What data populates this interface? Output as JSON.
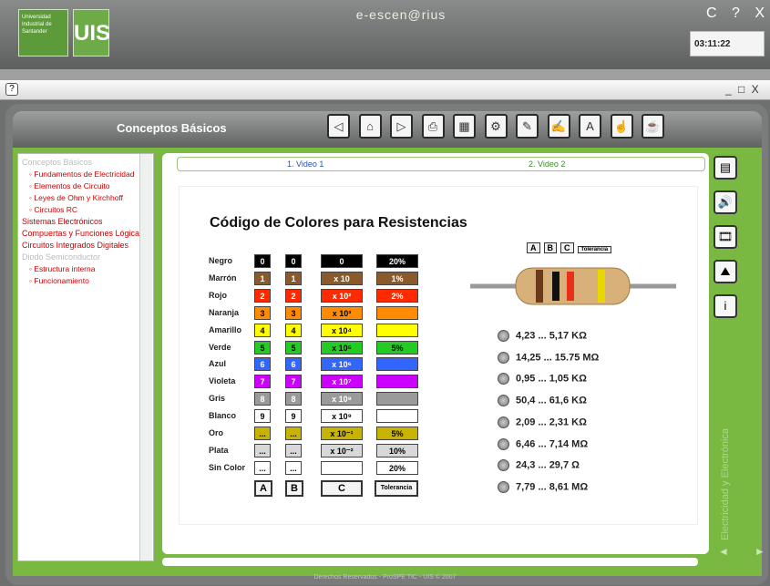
{
  "app": {
    "brand": "e-escen@rius",
    "window_controls": "C ? X",
    "clock": "03:11:22",
    "help": "?",
    "window_buttons": "_ □ X"
  },
  "logo": {
    "university": "Universidad Industrial de Santander",
    "mark": "UIS"
  },
  "header": {
    "title": "Conceptos Básicos",
    "tool_icons": [
      "prev-icon",
      "home-icon",
      "next-icon",
      "print-icon",
      "calculator-icon",
      "network-icon",
      "eraser-icon",
      "pen-icon",
      "font-icon",
      "pointer-icon",
      "cup-icon"
    ],
    "tool_glyphs": [
      "◁",
      "⌂",
      "▷",
      "⎙",
      "▦",
      "⚙",
      "✎",
      "✍",
      "A",
      "☝",
      "☕"
    ]
  },
  "sidebar": {
    "items": [
      {
        "type": "sec grey",
        "label": "Conceptos Básicos"
      },
      {
        "type": "sub",
        "label": "◦ Fundamentos de Electricidad"
      },
      {
        "type": "sub",
        "label": "◦ Elementos de Circuito"
      },
      {
        "type": "sub",
        "label": "◦ Leyes de Ohm y Kirchhoff"
      },
      {
        "type": "sub",
        "label": "◦ Circuitos RC"
      },
      {
        "type": "sec",
        "label": "Sistemas Electrónicos"
      },
      {
        "type": "sec",
        "label": "Compuertas y Funciones Lógicas"
      },
      {
        "type": "sec",
        "label": "Circuitos Integrados Digitales"
      },
      {
        "type": "sec grey",
        "label": "Diodo Semiconductor"
      },
      {
        "type": "sub",
        "label": "◦ Estructura interna"
      },
      {
        "type": "sub",
        "label": "◦ Funcionamiento"
      }
    ]
  },
  "tabs": {
    "video1": "1. Video 1",
    "video2": "2. Video 2"
  },
  "content": {
    "title": "Código de Colores para Resistencias",
    "rows": [
      {
        "label": "Negro",
        "d1": "0",
        "d2": "0",
        "mult": "0",
        "tol": "20%",
        "bg": "#000000",
        "fg": "#ffffff",
        "tolbg": "#000000",
        "tolfg": "#ffffff"
      },
      {
        "label": "Marrón",
        "d1": "1",
        "d2": "1",
        "mult": "x 10",
        "tol": "1%",
        "bg": "#8b5a2b",
        "fg": "#ffffff",
        "tolbg": "#8b5a2b",
        "tolfg": "#ffffff"
      },
      {
        "label": "Rojo",
        "d1": "2",
        "d2": "2",
        "mult": "x 10²",
        "tol": "2%",
        "bg": "#ff2a00",
        "fg": "#ffffff",
        "tolbg": "#ff2a00",
        "tolfg": "#ffffff"
      },
      {
        "label": "Naranja",
        "d1": "3",
        "d2": "3",
        "mult": "x 10³",
        "tol": "",
        "bg": "#ff8c00",
        "fg": "#000000",
        "tolbg": "#ff8c00",
        "tolfg": "#000000"
      },
      {
        "label": "Amarillo",
        "d1": "4",
        "d2": "4",
        "mult": "x 10⁴",
        "tol": "",
        "bg": "#ffff00",
        "fg": "#000000",
        "tolbg": "#ffff00",
        "tolfg": "#000000"
      },
      {
        "label": "Verde",
        "d1": "5",
        "d2": "5",
        "mult": "x 10⁵",
        "tol": "5%",
        "bg": "#22cc22",
        "fg": "#000000",
        "tolbg": "#22cc22",
        "tolfg": "#000000"
      },
      {
        "label": "Azul",
        "d1": "6",
        "d2": "6",
        "mult": "x 10⁶",
        "tol": "",
        "bg": "#3366ff",
        "fg": "#ffffff",
        "tolbg": "#3366ff",
        "tolfg": "#ffffff"
      },
      {
        "label": "Violeta",
        "d1": "7",
        "d2": "7",
        "mult": "x 10⁷",
        "tol": "",
        "bg": "#cc00ff",
        "fg": "#ffffff",
        "tolbg": "#cc00ff",
        "tolfg": "#ffffff"
      },
      {
        "label": "Gris",
        "d1": "8",
        "d2": "8",
        "mult": "x 10⁸",
        "tol": "",
        "bg": "#9a9a9a",
        "fg": "#ffffff",
        "tolbg": "#9a9a9a",
        "tolfg": "#ffffff"
      },
      {
        "label": "Blanco",
        "d1": "9",
        "d2": "9",
        "mult": "x 10⁹",
        "tol": "",
        "bg": "#ffffff",
        "fg": "#000000",
        "tolbg": "#ffffff",
        "tolfg": "#000000"
      },
      {
        "label": "Oro",
        "d1": "...",
        "d2": "...",
        "mult": "x 10⁻¹",
        "tol": "5%",
        "bg": "#c8b400",
        "fg": "#000000",
        "tolbg": "#c8b400",
        "tolfg": "#000000"
      },
      {
        "label": "Plata",
        "d1": "...",
        "d2": "...",
        "mult": "x 10⁻²",
        "tol": "10%",
        "bg": "#d8d8d8",
        "fg": "#000000",
        "tolbg": "#d8d8d8",
        "tolfg": "#000000"
      },
      {
        "label": "Sin Color",
        "d1": "...",
        "d2": "...",
        "mult": "",
        "tol": "20%",
        "bg": "#ffffff",
        "fg": "#000000",
        "tolbg": "#ffffff",
        "tolfg": "#000000"
      }
    ],
    "buttons": {
      "a": "A",
      "b": "B",
      "c": "C",
      "tol": "Tolerancia"
    },
    "legend": {
      "a": "A",
      "b": "B",
      "c": "C",
      "tol": "Tolerancia"
    },
    "options": [
      "4,23 ... 5,17  KΩ",
      "14,25 ... 15.75  MΩ",
      "0,95 ... 1,05  KΩ",
      "50,4 ... 61,6  KΩ",
      "2,09 ... 2,31  KΩ",
      "6,46 ... 7,14  MΩ",
      "24,3 ... 29,7  Ω",
      "7,79 ... 8,61  MΩ"
    ]
  },
  "right_tools": {
    "icons": [
      "document-icon",
      "audio-icon",
      "video-icon",
      "image-icon",
      "info-icon"
    ],
    "glyphs": [
      "▤",
      "🔊",
      "🎞",
      "⛰",
      "i"
    ]
  },
  "footer": {
    "copyright": "Derechos Reservados - ProSPE TIC - UIS © 2007",
    "vertical": "Electricidad y Electrónica",
    "nav_prev": "◄",
    "nav_next": "►"
  }
}
